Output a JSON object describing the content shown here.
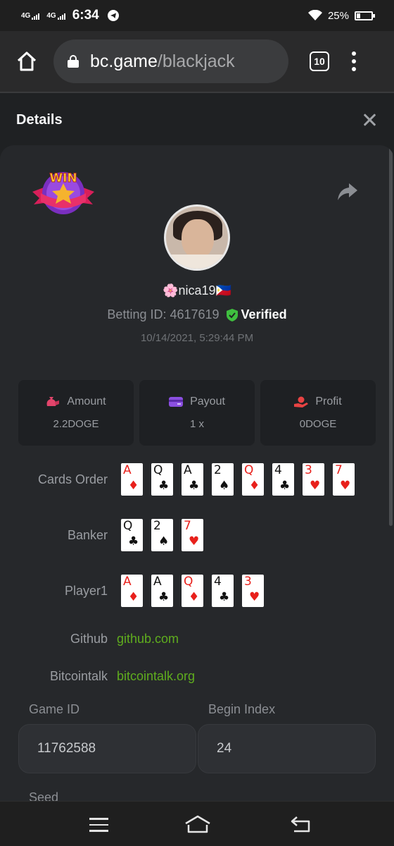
{
  "status": {
    "network1": "4G",
    "network2": "4G",
    "time": "6:34",
    "battery_text": "25%",
    "battery_level": 0.25
  },
  "browser": {
    "url_host": "bc.game",
    "url_path": "/blackjack",
    "tab_count": "10"
  },
  "dialog": {
    "title": "Details"
  },
  "bet": {
    "win_badge": "WIN",
    "username": "🌸nica19🇵🇭",
    "betting_id_label": "Betting ID: 4617619",
    "verified_label": "Verified",
    "date": "10/14/2021, 5:29:44 PM"
  },
  "stats": [
    {
      "label": "Amount",
      "value": "2.2DOGE",
      "icon": "money-bag-icon",
      "color": "#e2456b"
    },
    {
      "label": "Payout",
      "value": "1 x",
      "icon": "wallet-icon",
      "color": "#8b4fe0"
    },
    {
      "label": "Profit",
      "value": "0DOGE",
      "icon": "hand-coin-icon",
      "color": "#e84343"
    }
  ],
  "cards_order": {
    "label": "Cards Order",
    "cards": [
      {
        "rank": "A",
        "suit": "♦",
        "color": "red"
      },
      {
        "rank": "Q",
        "suit": "♣",
        "color": "black"
      },
      {
        "rank": "A",
        "suit": "♣",
        "color": "black"
      },
      {
        "rank": "2",
        "suit": "♠",
        "color": "black"
      },
      {
        "rank": "Q",
        "suit": "♦",
        "color": "red"
      },
      {
        "rank": "4",
        "suit": "♣",
        "color": "black"
      },
      {
        "rank": "3",
        "suit": "♥",
        "color": "red"
      },
      {
        "rank": "7",
        "suit": "♥",
        "color": "red"
      }
    ]
  },
  "banker": {
    "label": "Banker",
    "cards": [
      {
        "rank": "Q",
        "suit": "♣",
        "color": "black"
      },
      {
        "rank": "2",
        "suit": "♠",
        "color": "black"
      },
      {
        "rank": "7",
        "suit": "♥",
        "color": "red"
      }
    ]
  },
  "player1": {
    "label": "Player1",
    "cards": [
      {
        "rank": "A",
        "suit": "♦",
        "color": "red"
      },
      {
        "rank": "A",
        "suit": "♣",
        "color": "black"
      },
      {
        "rank": "Q",
        "suit": "♦",
        "color": "red"
      },
      {
        "rank": "4",
        "suit": "♣",
        "color": "black"
      },
      {
        "rank": "3",
        "suit": "♥",
        "color": "red"
      }
    ]
  },
  "links": {
    "github_label": "Github",
    "github_value": "github.com",
    "bitcointalk_label": "Bitcointalk",
    "bitcointalk_value": "bitcointalk.org"
  },
  "fields": {
    "game_id_label": "Game ID",
    "game_id_value": "11762588",
    "begin_index_label": "Begin Index",
    "begin_index_value": "24",
    "seed_label": "Seed"
  },
  "colors": {
    "accent_green": "#5fad1e",
    "verified_green": "#3fbf3f",
    "background": "#1f2123",
    "panel": "#26282b"
  }
}
